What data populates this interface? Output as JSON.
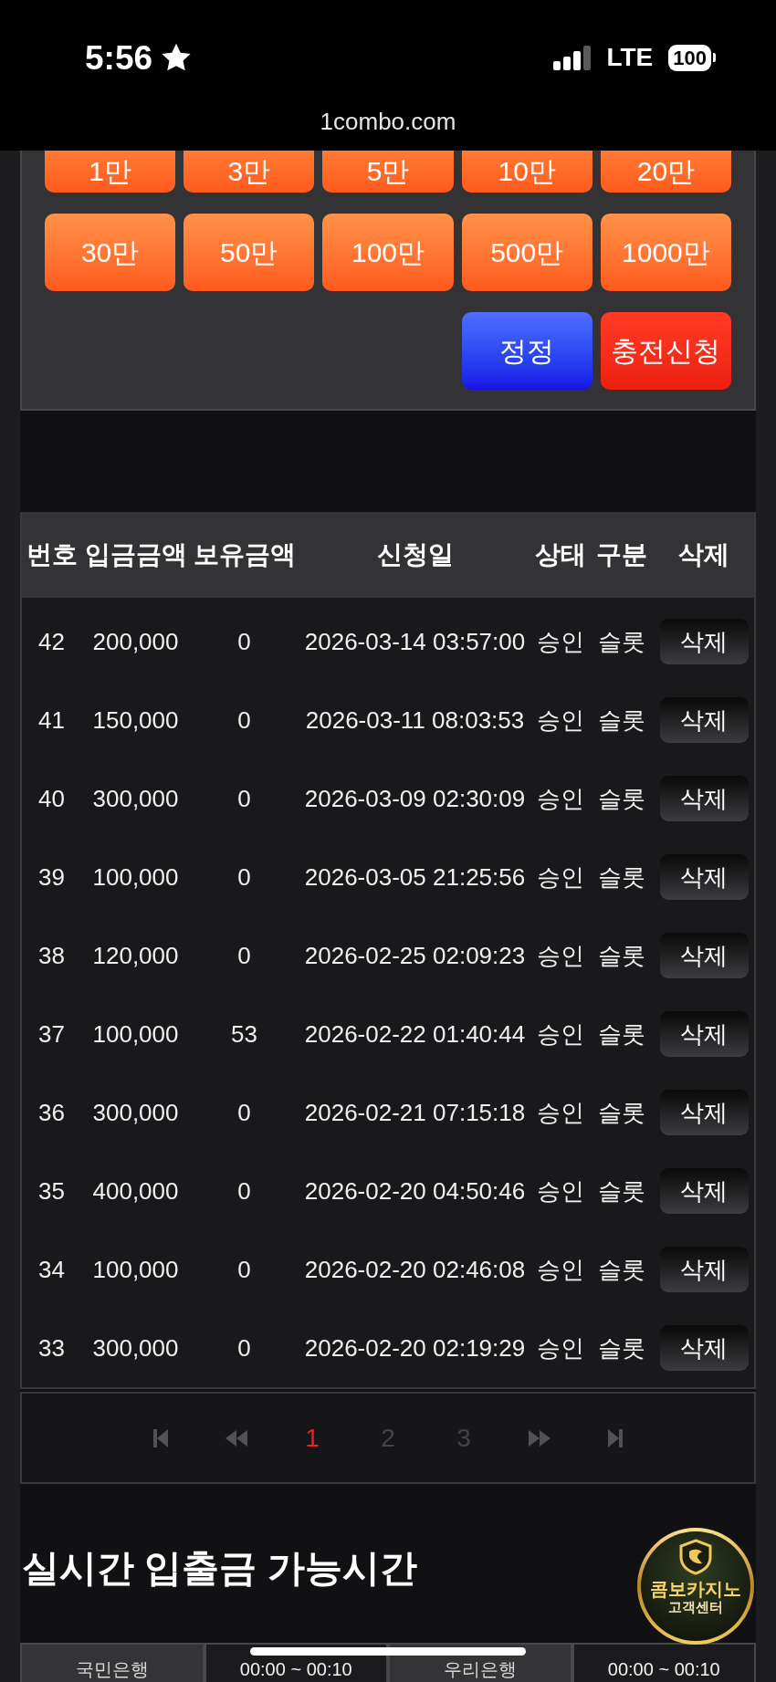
{
  "status_bar": {
    "time": "5:56",
    "network": "LTE",
    "battery": "100"
  },
  "browser": {
    "url": "1combo.com"
  },
  "amount_buttons": [
    "1만",
    "3만",
    "5만",
    "10만",
    "20만",
    "30만",
    "50만",
    "100만",
    "500만",
    "1000만"
  ],
  "actions": [
    {
      "label": "정정",
      "kind": "reset"
    },
    {
      "label": "충전신청",
      "kind": "apply"
    }
  ],
  "deposit_table": {
    "columns": [
      "번호",
      "입금금액",
      "보유금액",
      "신청일",
      "상태",
      "구분",
      "삭제"
    ],
    "rows": [
      {
        "no": "42",
        "deposit": "200,000",
        "balance": "0",
        "date": "2026-03-14 03:57:00",
        "status": "승인",
        "category": "슬롯",
        "action": "삭제"
      },
      {
        "no": "41",
        "deposit": "150,000",
        "balance": "0",
        "date": "2026-03-11 08:03:53",
        "status": "승인",
        "category": "슬롯",
        "action": "삭제"
      },
      {
        "no": "40",
        "deposit": "300,000",
        "balance": "0",
        "date": "2026-03-09 02:30:09",
        "status": "승인",
        "category": "슬롯",
        "action": "삭제"
      },
      {
        "no": "39",
        "deposit": "100,000",
        "balance": "0",
        "date": "2026-03-05 21:25:56",
        "status": "승인",
        "category": "슬롯",
        "action": "삭제"
      },
      {
        "no": "38",
        "deposit": "120,000",
        "balance": "0",
        "date": "2026-02-25 02:09:23",
        "status": "승인",
        "category": "슬롯",
        "action": "삭제"
      },
      {
        "no": "37",
        "deposit": "100,000",
        "balance": "53",
        "date": "2026-02-22 01:40:44",
        "status": "승인",
        "category": "슬롯",
        "action": "삭제"
      },
      {
        "no": "36",
        "deposit": "300,000",
        "balance": "0",
        "date": "2026-02-21 07:15:18",
        "status": "승인",
        "category": "슬롯",
        "action": "삭제"
      },
      {
        "no": "35",
        "deposit": "400,000",
        "balance": "0",
        "date": "2026-02-20 04:50:46",
        "status": "승인",
        "category": "슬롯",
        "action": "삭제"
      },
      {
        "no": "34",
        "deposit": "100,000",
        "balance": "0",
        "date": "2026-02-20 02:46:08",
        "status": "승인",
        "category": "슬롯",
        "action": "삭제"
      },
      {
        "no": "33",
        "deposit": "300,000",
        "balance": "0",
        "date": "2026-02-20 02:19:29",
        "status": "승인",
        "category": "슬롯",
        "action": "삭제"
      }
    ]
  },
  "pagination": {
    "pages": [
      {
        "label": "1",
        "selected": true
      },
      {
        "label": "2",
        "selected": false
      },
      {
        "label": "3",
        "selected": false
      }
    ]
  },
  "hours_section": {
    "title": "실시간 입출금 가능시간",
    "cells": [
      {
        "text": "국민은행",
        "kind": "bank"
      },
      {
        "text": "00:00 ~ 00:10",
        "kind": "time"
      },
      {
        "text": "우리은행",
        "kind": "bank"
      },
      {
        "text": "00:00 ~ 00:10",
        "kind": "time"
      }
    ]
  },
  "help_badge": {
    "title": "콤보카지노",
    "subtitle": "고객센터"
  }
}
